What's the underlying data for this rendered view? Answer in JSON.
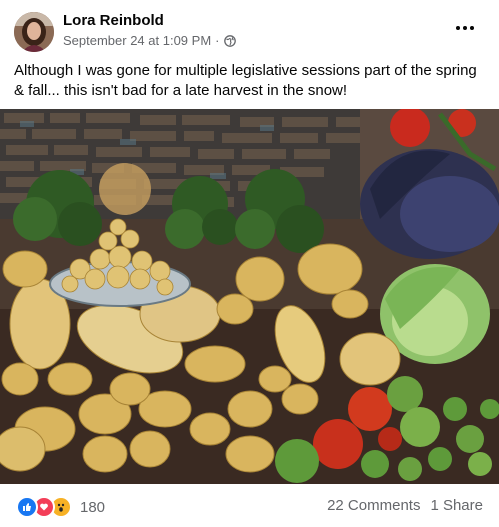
{
  "post": {
    "author": "Lora Reinbold",
    "timestamp": "September 24 at 1:09 PM",
    "separator": "·",
    "audience_icon": "globe-icon",
    "text": "Although I was gone for multiple legislative sessions part of the spring & fall... this isn't bad for a late harvest in the snow!",
    "photo_subject": "harvest-vegetables-photo"
  },
  "footer": {
    "reaction_icons": [
      "like-icon",
      "love-icon",
      "wow-icon"
    ],
    "reaction_count": "180",
    "comments": "22 Comments",
    "shares": "1 Share"
  },
  "colors": {
    "like": "#1877f2",
    "love": "#f33e58",
    "wow": "#f7b125",
    "secondary_text": "#65676b"
  }
}
